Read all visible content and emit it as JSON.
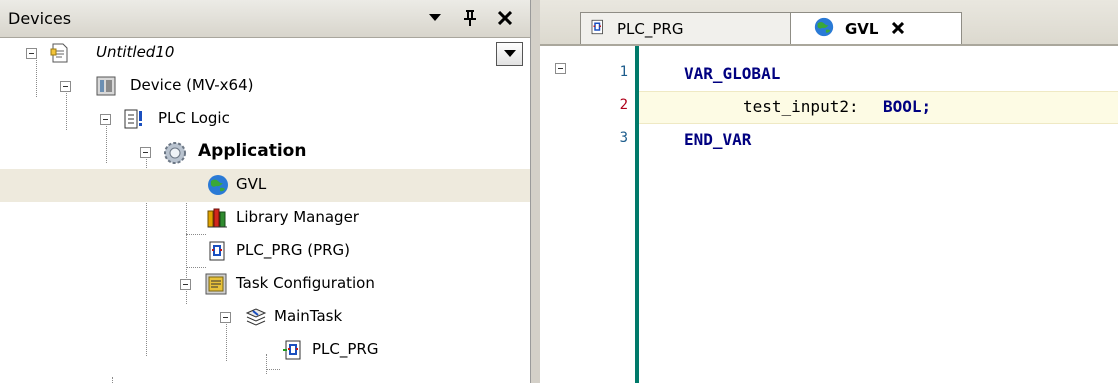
{
  "devices_pane": {
    "title": "Devices",
    "pin_glyph": "❡",
    "close_glyph": "✖",
    "dropdown_glyph": "▼"
  },
  "tree": {
    "project": "Untitled10",
    "device": "Device (MV-x64)",
    "plc_logic": "PLC Logic",
    "application": "Application",
    "gvl": "GVL",
    "library_manager": "Library Manager",
    "plc_prg": "PLC_PRG (PRG)",
    "task_configuration": "Task Configuration",
    "main_task": "MainTask",
    "main_task_prg": "PLC_PRG"
  },
  "editor": {
    "tabs": [
      {
        "label": "PLC_PRG",
        "active": false
      },
      {
        "label": "GVL",
        "active": true,
        "close": "✖"
      }
    ],
    "lines": [
      {
        "num": "1",
        "kw": "VAR_GLOBAL",
        "text": ""
      },
      {
        "num": "2",
        "ident": "test_input2:",
        "kw": "BOOL;"
      },
      {
        "num": "3",
        "kw": "END_VAR",
        "text": ""
      }
    ]
  },
  "colors": {
    "keyword": "#000080",
    "gutter_bar": "#007a6a",
    "selection": "#eeeadd",
    "current_line": "#fdfbe4"
  }
}
